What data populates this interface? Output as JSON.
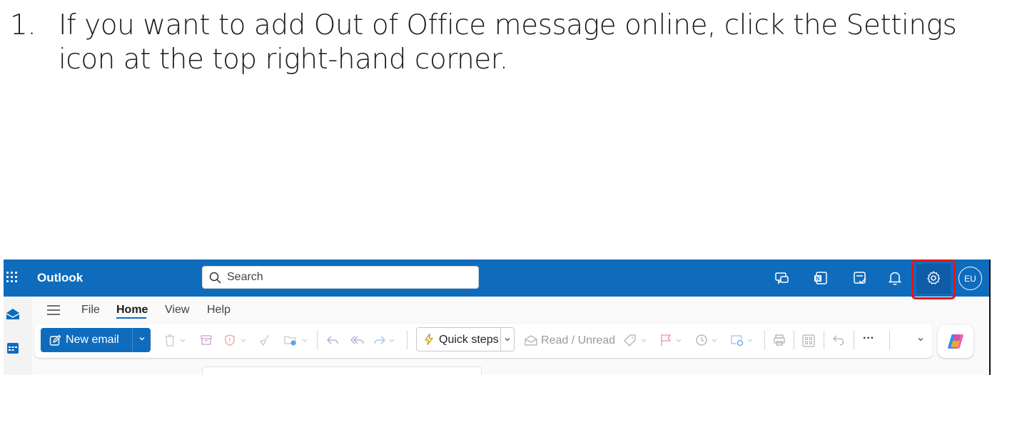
{
  "instruction": {
    "number": "1.",
    "text": "If you want to add Out of Office message online, click the Settings icon at the top right-hand corner."
  },
  "app": {
    "name": "Outlook",
    "search_placeholder": "Search",
    "avatar_initials": "EU"
  },
  "topbar_icons": [
    "teams-chat-icon",
    "onenote-icon",
    "todo-icon",
    "bell-icon",
    "settings-icon"
  ],
  "menu": {
    "items": [
      {
        "label": "File",
        "active": false
      },
      {
        "label": "Home",
        "active": true
      },
      {
        "label": "View",
        "active": false
      },
      {
        "label": "Help",
        "active": false
      }
    ]
  },
  "ribbon": {
    "new_email_label": "New email",
    "quick_steps_label": "Quick steps",
    "read_unread_label": "Read / Unread",
    "more_label": "···"
  },
  "colors": {
    "brand": "#0f6cbd",
    "highlight": "#e8141b"
  }
}
